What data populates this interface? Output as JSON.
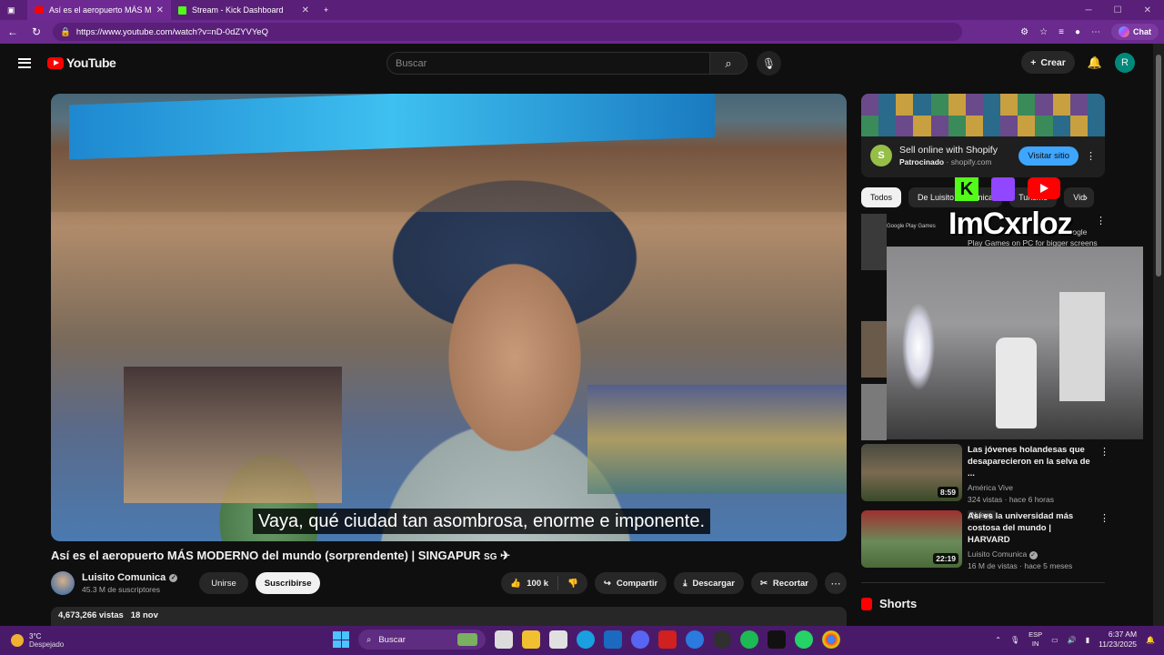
{
  "browser": {
    "tabs": [
      {
        "title": "Así es el aeropuerto MÁS MODERNO del mundo (sorprendente) | SINGAPUR",
        "active": true
      },
      {
        "title": "Stream - Kick Dashboard",
        "active": false
      }
    ],
    "url": "https://www.youtube.com/watch?v=nD-0dZYVYeQ",
    "chat_label": "Chat"
  },
  "header": {
    "logo_text": "YouTube",
    "search_placeholder": "Buscar",
    "create_label": "Crear",
    "avatar_letter": "R"
  },
  "video": {
    "subtitle": "Vaya, qué ciudad tan asombrosa, enorme e imponente.",
    "title": "Así es el aeropuerto MÁS MODERNO del mundo (sorprendente) | SINGAPUR",
    "title_suffix": "SG",
    "channel_name": "Luisito Comunica",
    "subscribers": "45.3 M de suscriptores",
    "join_label": "Unirse",
    "subscribe_label": "Suscribirse",
    "likes": "100 k",
    "share_label": "Compartir",
    "download_label": "Descargar",
    "clip_label": "Recortar",
    "views": "4,673,266 vistas",
    "date": "18 nov"
  },
  "sidebar": {
    "ad": {
      "title": "Sell online with Shopify",
      "sponsored": "Patrocinado",
      "domain": "shopify.com",
      "visit_label": "Visitar sitio"
    },
    "chips": [
      "Todos",
      "De Luisito Comunica",
      "Turismo",
      "Vid"
    ],
    "overlay": {
      "streamer_name": "ImCxrloz",
      "gp_label": "Google Play Games",
      "gp_line1": "Google",
      "gp_line2": "Play Games on PC for bigger screens"
    },
    "related": [
      {
        "title": "Las jóvenes holandesas que desaparecieron en la selva de ...",
        "channel": "América Vive",
        "meta": "324 vistas · hace 6 horas",
        "duration": "8:59",
        "badge": "Nuevo"
      },
      {
        "title": "Así es la universidad más costosa del mundo | HARVARD",
        "channel": "Luisito Comunica",
        "meta": "16 M de vistas · hace 5 meses",
        "duration": "22:19"
      }
    ],
    "shorts_label": "Shorts"
  },
  "taskbar": {
    "temp": "3°C",
    "condition": "Despejado",
    "search_label": "Buscar",
    "lang_top": "ESP",
    "lang_bottom": "IN",
    "time": "6:37 AM",
    "date": "11/23/2025"
  }
}
